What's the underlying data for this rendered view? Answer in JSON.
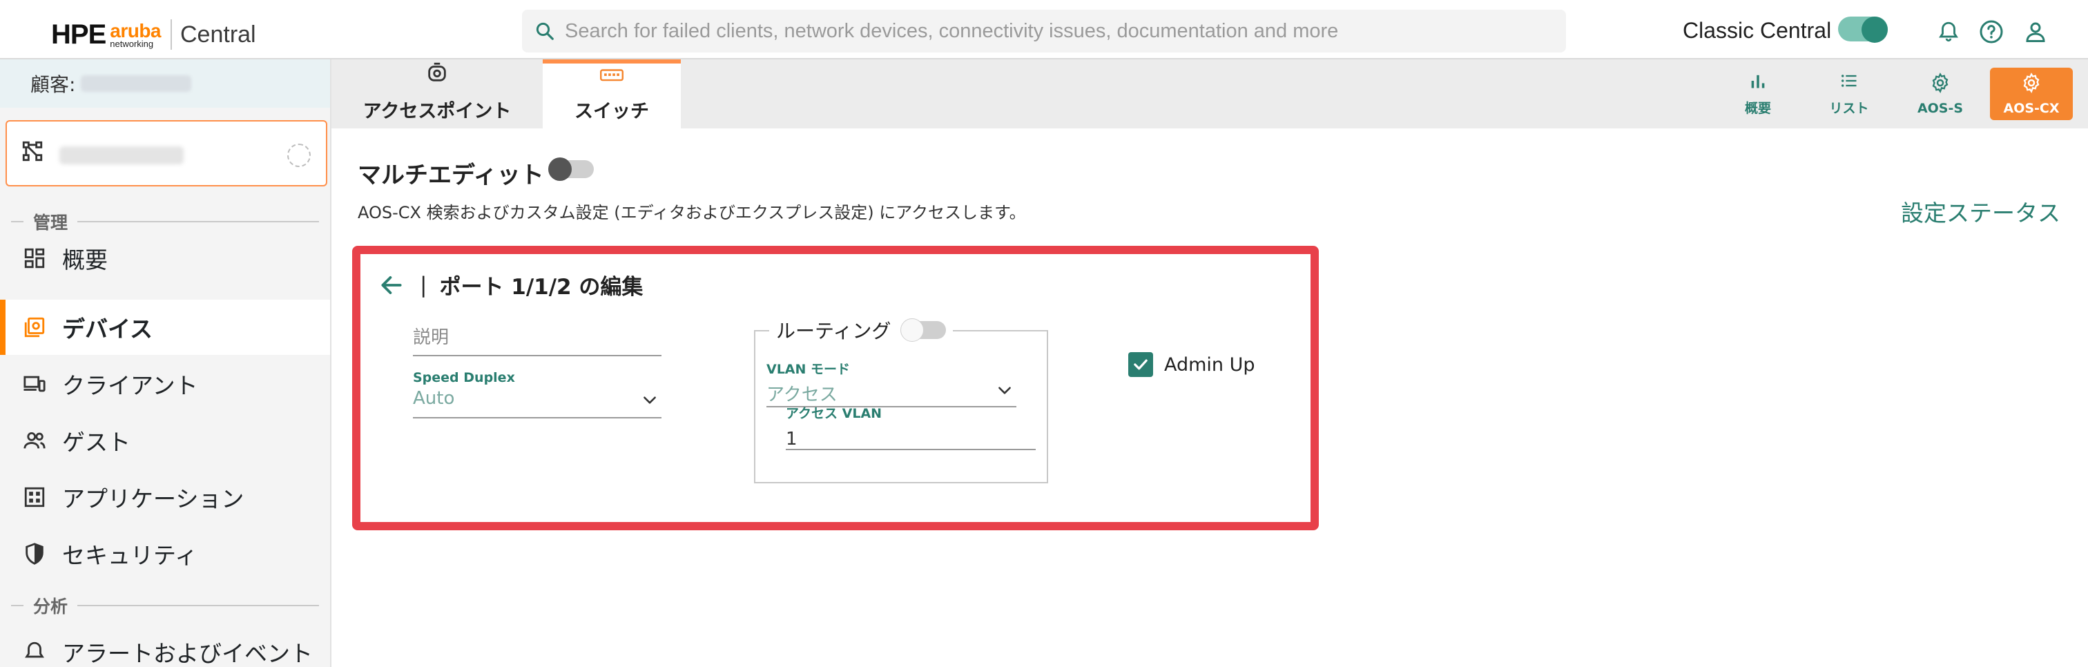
{
  "header": {
    "logo_hpe": "HPE",
    "logo_aruba": "aruba",
    "logo_networking": "networking",
    "logo_product": "Central",
    "search_placeholder": "Search for failed clients, network devices, connectivity issues, documentation and more",
    "classic_label": "Classic Central",
    "classic_toggle_on": true,
    "icons": [
      "bell-icon",
      "help-icon",
      "user-icon"
    ]
  },
  "sidebar": {
    "customer_label": "顧客:",
    "sections": [
      {
        "label": "管理"
      },
      {
        "label": "分析"
      }
    ],
    "items": [
      {
        "label": "概要",
        "icon": "grid-icon",
        "active": false
      },
      {
        "label": "デバイス",
        "icon": "devices-icon",
        "active": true
      },
      {
        "label": "クライアント",
        "icon": "clients-icon",
        "active": false
      },
      {
        "label": "ゲスト",
        "icon": "guests-icon",
        "active": false
      },
      {
        "label": "アプリケーション",
        "icon": "apps-icon",
        "active": false
      },
      {
        "label": "セキュリティ",
        "icon": "shield-icon",
        "active": false
      },
      {
        "label": "アラートおよびイベント",
        "icon": "bell-icon",
        "active": false
      }
    ]
  },
  "tabs": [
    {
      "label": "アクセスポイント",
      "icon": "access-point-icon",
      "active": false
    },
    {
      "label": "スイッチ",
      "icon": "switch-icon",
      "active": true
    }
  ],
  "view_buttons": [
    {
      "label": "概要",
      "icon": "bar-chart-icon",
      "active": false
    },
    {
      "label": "リスト",
      "icon": "list-icon",
      "active": false
    },
    {
      "label": "AOS-S",
      "icon": "gear-icon",
      "active": false
    },
    {
      "label": "AOS-CX",
      "icon": "gear-icon",
      "active": true
    }
  ],
  "main": {
    "multi_edit_label": "マルチエディット",
    "multi_edit_on": false,
    "description": "AOS-CX 検索およびカスタム設定 (エディタおよびエクスプレス設定) にアクセスします。",
    "config_status_link": "設定ステータス"
  },
  "edit_panel": {
    "title": "ポート 1/1/2 の編集",
    "separator": "|",
    "description_placeholder": "説明",
    "speed_duplex_label": "Speed Duplex",
    "speed_duplex_value": "Auto",
    "routing_label": "ルーティング",
    "routing_on": false,
    "vlan_mode_label": "VLAN モード",
    "vlan_mode_value": "アクセス",
    "access_vlan_label": "アクセス VLAN",
    "access_vlan_value": "1",
    "admin_up_label": "Admin Up",
    "admin_up_checked": true
  },
  "colors": {
    "accent_orange": "#ff8300",
    "teal": "#2a7e70",
    "highlight_red": "#e8414a"
  }
}
